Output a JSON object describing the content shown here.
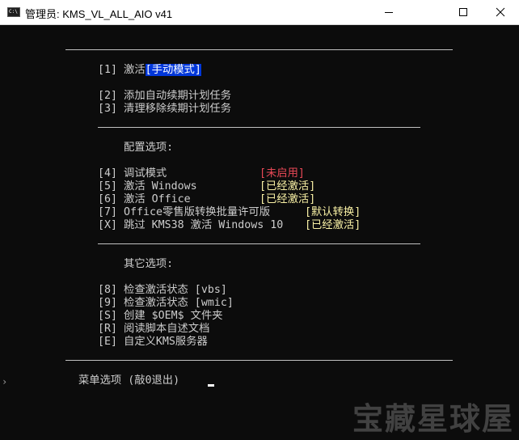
{
  "window": {
    "title": "管理员:  KMS_VL_ALL_AIO v41"
  },
  "menu": {
    "activate": {
      "key": "[1]",
      "label": "激活",
      "mode": "[手动模式]"
    },
    "add_task": "[2] 添加自动续期计划任务",
    "clean_task": "[3] 清理移除续期计划任务",
    "config_header": "配置选项:",
    "config": [
      {
        "key": "[4] 调试模式",
        "status": "[未启用]",
        "color": "#e74856"
      },
      {
        "key": "[5] 激活 Windows",
        "status": "[已经激活]",
        "color": "#f9f1a5"
      },
      {
        "key": "[6] 激活 Office",
        "status": "[已经激活]",
        "color": "#f9f1a5"
      },
      {
        "key": "[7] Office零售版转换批量许可版",
        "status": "[默认转换]",
        "color": "#f9f1a5"
      },
      {
        "key": "[X] 跳过 KMS38 激活 Windows 10",
        "status": "[已经激活]",
        "color": "#f9f1a5"
      }
    ],
    "other_header": "其它选项:",
    "other": [
      "[8] 检查激活状态 [vbs]",
      "[9] 检查激活状态 [wmic]",
      "[S] 创建 $OEM$ 文件夹",
      "[R] 阅读脚本自述文档",
      "[E] 自定义KMS服务器"
    ],
    "prompt": "菜单选项 (敲0退出)"
  },
  "watermark": "宝藏星球屋"
}
